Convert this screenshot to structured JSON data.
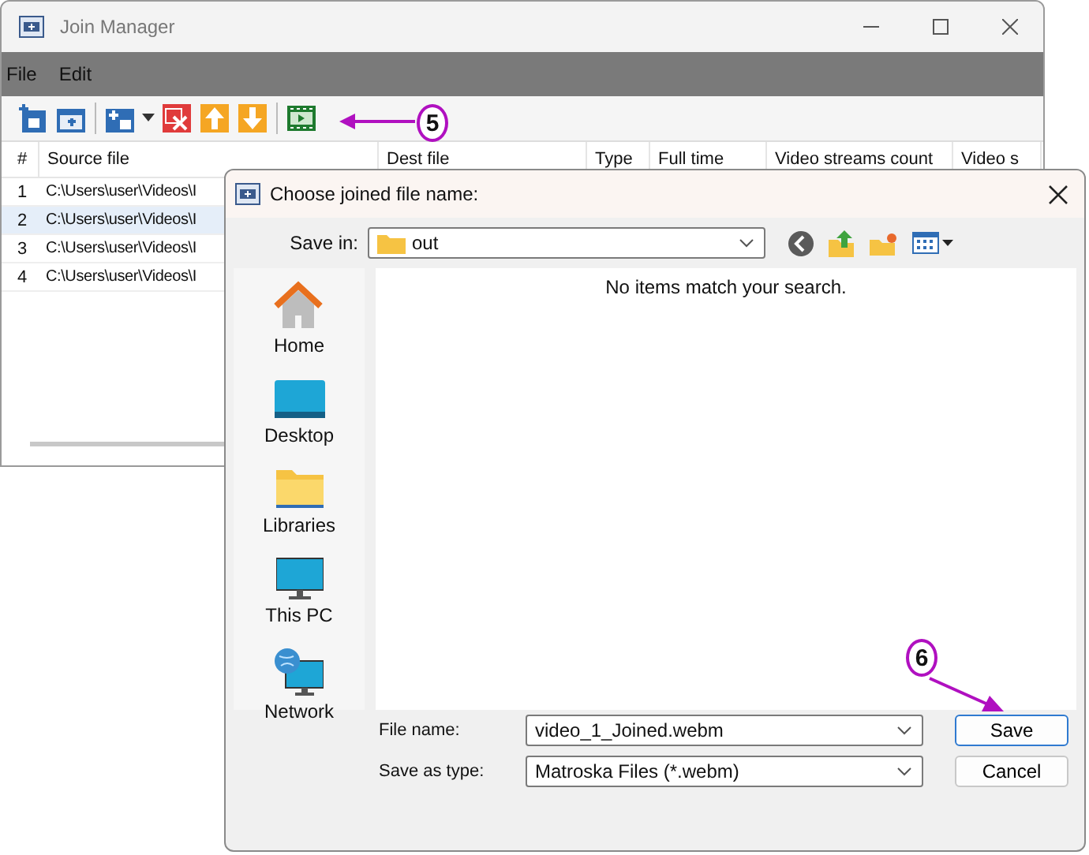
{
  "main_window": {
    "title": "Join Manager",
    "menu": [
      "File",
      "Edit"
    ],
    "table": {
      "columns": [
        "#",
        "Source file",
        "Dest file",
        "Type",
        "Full time",
        "Video streams count",
        "Video s"
      ],
      "rows": [
        {
          "index": "1",
          "source_file": "C:\\Users\\user\\Videos\\I",
          "selected": false
        },
        {
          "index": "2",
          "source_file": "C:\\Users\\user\\Videos\\I",
          "selected": true
        },
        {
          "index": "3",
          "source_file": "C:\\Users\\user\\Videos\\I",
          "selected": false
        },
        {
          "index": "4",
          "source_file": "C:\\Users\\user\\Videos\\I",
          "selected": false
        }
      ]
    }
  },
  "dialog": {
    "title": "Choose joined file name:",
    "save_in_label": "Save in:",
    "save_in_folder": "out",
    "empty_message": "No items match your search.",
    "places": [
      {
        "label": "Home",
        "kind": "home"
      },
      {
        "label": "Desktop",
        "kind": "desktop"
      },
      {
        "label": "Libraries",
        "kind": "libraries"
      },
      {
        "label": "This PC",
        "kind": "pc"
      },
      {
        "label": "Network",
        "kind": "network"
      }
    ],
    "file_name_label": "File name:",
    "file_name": "video_1_Joined.webm",
    "save_type_label": "Save as type:",
    "save_type": "Matroska Files (*.webm)",
    "buttons": [
      {
        "label": "Save",
        "default": true
      },
      {
        "label": "Cancel",
        "default": false
      }
    ]
  },
  "annotations": [
    {
      "label": "5"
    },
    {
      "label": "6"
    }
  ]
}
